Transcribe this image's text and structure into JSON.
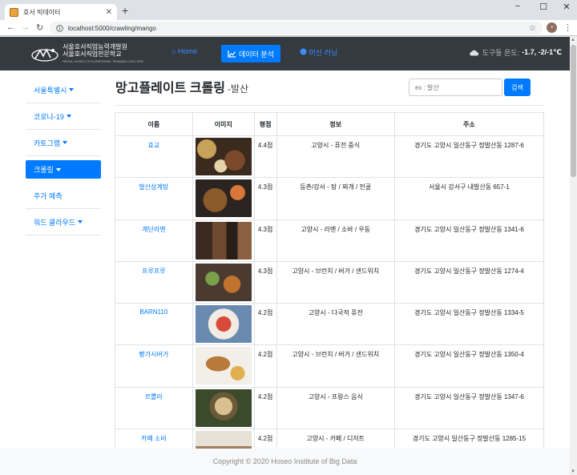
{
  "browser": {
    "tab_title": "호서 빅데이터",
    "url": "localhost:5000/crawling/mango"
  },
  "navbar": {
    "logo_line1": "서울호서직업능력개발원",
    "logo_line2": "서울호서직업전문학교",
    "logo_line3": "SEOUL HOSEO OCCUPATIONAL TRAINING COLLEGE",
    "home": "Home",
    "data_analysis": "데이터 분석",
    "machine_learning": "머신 러닝",
    "weather_label": "도구동 온도:",
    "weather_value": "-1.7, -2/-1℃"
  },
  "sidebar": {
    "items": [
      {
        "label": "서울특별시",
        "dropdown": true,
        "active": false
      },
      {
        "label": "코로나-19",
        "dropdown": true,
        "active": false
      },
      {
        "label": "카토그램",
        "dropdown": true,
        "active": false
      },
      {
        "label": "크롤링",
        "dropdown": true,
        "active": true
      },
      {
        "label": "주가 예측",
        "dropdown": false,
        "active": false
      },
      {
        "label": "워드 클라우드",
        "dropdown": true,
        "active": false
      }
    ]
  },
  "main": {
    "title": "망고플레이트 크롤링",
    "subtitle": "-발산",
    "search_placeholder": "ex : 발산",
    "search_button": "검색",
    "columns": [
      "이름",
      "이미지",
      "평점",
      "정보",
      "주소"
    ],
    "rows": [
      {
        "name": "효교",
        "rating": "4.4점",
        "info": "고양시 - 퓨전 중식",
        "address": "경기도 고양시 일산동구 정발산동 1287-6"
      },
      {
        "name": "발산삼계탕",
        "rating": "4.3점",
        "info": "등촌/강서 - 탕 / 찌개 / 전골",
        "address": "서울시 강서구 내발산동 657-1"
      },
      {
        "name": "계단라멘",
        "rating": "4.3점",
        "info": "고양시 - 라멘 / 소바 / 우동",
        "address": "경기도 고양시 일산동구 정발산동 1341-6"
      },
      {
        "name": "프루프루",
        "rating": "4.3점",
        "info": "고양시 - 브런치 / 버거 / 샌드위치",
        "address": "경기도 고양시 일산동구 정발산동 1274-4"
      },
      {
        "name": "BARN110",
        "rating": "4.2점",
        "info": "고양시 - 다국적 퓨전",
        "address": "경기도 고양시 일산동구 정발산동 1334-5"
      },
      {
        "name": "빵가시버거",
        "rating": "4.2점",
        "info": "고양시 - 브런치 / 버거 / 샌드위치",
        "address": "경기도 고양시 일산동구 정발산동 1350-4"
      },
      {
        "name": "르쁠라",
        "rating": "4.2점",
        "info": "고양시 - 프랑스 음식",
        "address": "경기도 고양시 일산동구 정발산동 1347-6"
      },
      {
        "name": "카페 소비",
        "rating": "4.2점",
        "info": "고양시 - 카페 / 디저트",
        "address": "경기도 고양시 일산동구 정발산동 1285-15"
      }
    ]
  },
  "footer": {
    "copyright": "Copyright © 2020 Hoseo Institute of Big Data"
  }
}
